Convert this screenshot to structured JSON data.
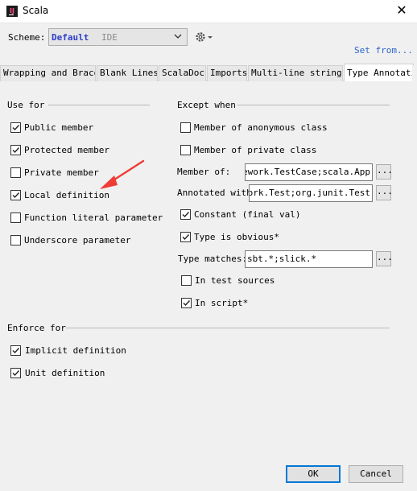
{
  "window": {
    "title": "Scala",
    "app_icon_text": "IJ"
  },
  "scheme": {
    "label": "Scheme:",
    "value": "Default",
    "tag": "IDE",
    "set_from": "Set from..."
  },
  "tabs": [
    {
      "label": "Wrapping and Braces"
    },
    {
      "label": "Blank Lines"
    },
    {
      "label": "ScalaDoc"
    },
    {
      "label": "Imports"
    },
    {
      "label": "Multi-line strings"
    },
    {
      "label": "Type Annotati",
      "active": true
    }
  ],
  "use_for": {
    "title": "Use for",
    "items": [
      {
        "label": "Public member",
        "checked": true
      },
      {
        "label": "Protected member",
        "checked": true
      },
      {
        "label": "Private member",
        "checked": false
      },
      {
        "label": "Local definition",
        "checked": true
      },
      {
        "label": "Function literal parameter",
        "checked": false
      },
      {
        "label": "Underscore parameter",
        "checked": false
      }
    ]
  },
  "except_when": {
    "title": "Except when",
    "member_anonymous": {
      "label": "Member of anonymous class",
      "checked": false
    },
    "member_private": {
      "label": "Member of private class",
      "checked": false
    },
    "member_of": {
      "label": "Member of:",
      "value": "mework.TestCase;scala.App"
    },
    "annotated_with": {
      "label": "Annotated with:",
      "value": "ework.Test;org.junit.Test"
    },
    "constant": {
      "label": "Constant (final val)",
      "checked": true
    },
    "type_obvious": {
      "label": "Type is obvious*",
      "checked": true
    },
    "type_matches": {
      "label": "Type matches:",
      "value": "sbt.*;slick.*"
    },
    "in_test_sources": {
      "label": "In test sources",
      "checked": false
    },
    "in_script": {
      "label": "In script*",
      "checked": true
    },
    "ellipsis": "..."
  },
  "enforce_for": {
    "title": "Enforce for",
    "items": [
      {
        "label": "Implicit definition",
        "checked": true
      },
      {
        "label": "Unit definition",
        "checked": true
      }
    ]
  },
  "buttons": {
    "ok": "OK",
    "cancel": "Cancel"
  },
  "colors": {
    "accent": "#2c3ec8",
    "link": "#2f65ca",
    "arrow": "#ee3c36"
  }
}
